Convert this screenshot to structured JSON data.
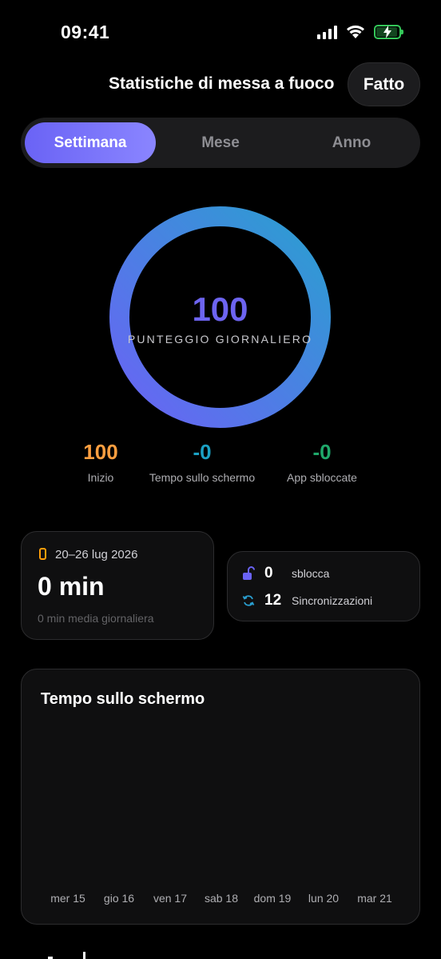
{
  "status_bar": {
    "time": "09:41"
  },
  "header": {
    "title": "Statistiche di messa a fuoco",
    "done_label": "Fatto"
  },
  "tabs": [
    {
      "label": "Settimana",
      "active": true
    },
    {
      "label": "Mese",
      "active": false
    },
    {
      "label": "Anno",
      "active": false
    }
  ],
  "score": {
    "value": "100",
    "label": "PUNTEGGIO GIORNALIERO",
    "progress": 1.0
  },
  "metrics": [
    {
      "value": "100",
      "label": "Inizio",
      "color": "#ff9f40"
    },
    {
      "value": "-0",
      "label": "Tempo sullo schermo",
      "color": "#1ba1c4"
    },
    {
      "value": "-0",
      "label": "App sbloccate",
      "color": "#1fa86a"
    }
  ],
  "week_card": {
    "range": "20–26 lug 2026",
    "total": "0 min",
    "average": "0 min media giornaliera"
  },
  "stats_card": {
    "unlocks": {
      "value": "0",
      "label": "sblocca",
      "icon": "unlock-icon"
    },
    "syncs": {
      "value": "12",
      "label": "Sincronizzazioni",
      "icon": "sync-icon"
    }
  },
  "colors": {
    "accent": "#6a63f5",
    "ring_start": "#6a63f5",
    "ring_end": "#2a9fd0"
  },
  "chart_data": {
    "type": "bar",
    "title": "Tempo sullo schermo",
    "categories": [
      "mer 15",
      "gio 16",
      "ven 17",
      "sab 18",
      "dom 19",
      "lun 20",
      "mar 21"
    ],
    "values": [
      0,
      0,
      0,
      0,
      0,
      0,
      0
    ],
    "xlabel": "",
    "ylabel": "",
    "grid": false
  }
}
